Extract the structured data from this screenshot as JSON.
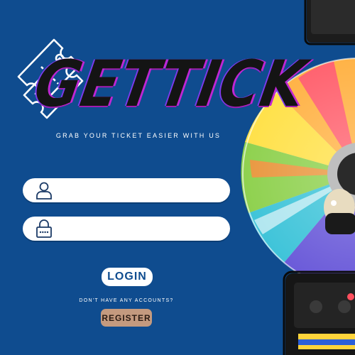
{
  "logo": {
    "text": "GETTICK",
    "icon": "ticket-icon"
  },
  "tagline": "GRAB YOUR TICKET EASIER WITH US",
  "username_field": {
    "icon": "user-icon",
    "value": "",
    "placeholder": ""
  },
  "password_field": {
    "icon": "lock-icon",
    "value": "",
    "placeholder": ""
  },
  "login_label": "LOGIN",
  "no_account_text": "DON'T HAVE ANY ACCOUNTS?",
  "register_label": "REGISTER",
  "colors": {
    "background": "#0f4c8f",
    "login_text": "#0f4c8f",
    "register_button": "#c49a7f",
    "logo_glow": "#c026d3"
  }
}
